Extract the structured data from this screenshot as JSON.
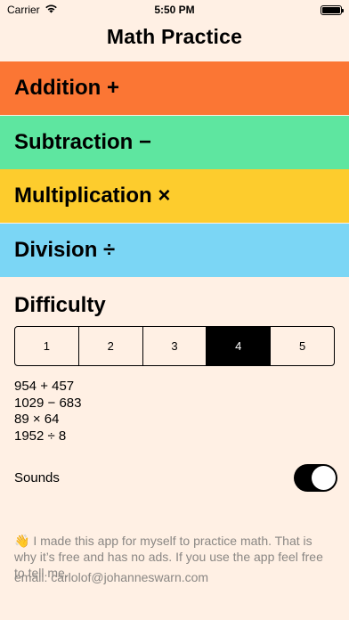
{
  "status_bar": {
    "carrier": "Carrier",
    "time": "5:50 PM",
    "icons": [
      "wifi-icon",
      "battery-icon"
    ]
  },
  "nav": {
    "title": "Math Practice"
  },
  "operations": [
    {
      "label": "Addition +",
      "color": "#fb7634"
    },
    {
      "label": "Subtraction −",
      "color": "#5ee6a0"
    },
    {
      "label": "Multiplication ×",
      "color": "#fdcc2d"
    },
    {
      "label": "Division ÷",
      "color": "#7bd6f5"
    }
  ],
  "difficulty": {
    "title": "Difficulty",
    "options": [
      "1",
      "2",
      "3",
      "4",
      "5"
    ],
    "selected": "4"
  },
  "examples": [
    "954 + 457",
    "1029 − 683",
    "89 × 64",
    "1952 ÷ 8"
  ],
  "sounds": {
    "label": "Sounds",
    "enabled": true
  },
  "about": {
    "text": "👋 I made this app for myself to practice math. That is why it’s free and has no ads. If you use the app feel free to tell me.",
    "email": "email: carlolof@johanneswarn.com"
  }
}
